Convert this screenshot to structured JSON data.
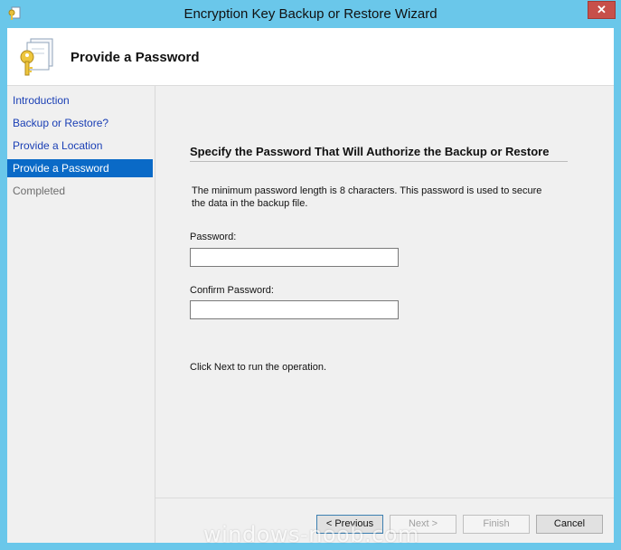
{
  "window": {
    "title": "Encryption Key Backup or Restore Wizard",
    "close_symbol": "✕",
    "app_icon": "wizard-key-icon"
  },
  "header": {
    "title": "Provide a Password",
    "icon": "document-key-icon"
  },
  "nav": {
    "items": [
      {
        "label": "Introduction",
        "state": "link"
      },
      {
        "label": "Backup or Restore?",
        "state": "link"
      },
      {
        "label": "Provide a Location",
        "state": "link"
      },
      {
        "label": "Provide a Password",
        "state": "selected"
      },
      {
        "label": "Completed",
        "state": "disabled"
      }
    ],
    "selected_color": "#0a6ac7"
  },
  "main": {
    "section_title": "Specify the Password That Will Authorize the Backup or Restore",
    "description_line1": "The minimum password length is 8 characters.  This password is used to secure",
    "description_line2": "the data in the backup file.",
    "password_label": "Password:",
    "password_value": "",
    "confirm_label": "Confirm Password:",
    "confirm_value": "",
    "hint": "Click Next to run the operation."
  },
  "buttons": {
    "previous": "< Previous",
    "next": "Next >",
    "finish": "Finish",
    "cancel": "Cancel"
  },
  "watermark": "windows-noob.com",
  "colors": {
    "titlebar": "#6ac7ea",
    "close_button": "#c7504a",
    "link_text": "#1a3fb5"
  }
}
